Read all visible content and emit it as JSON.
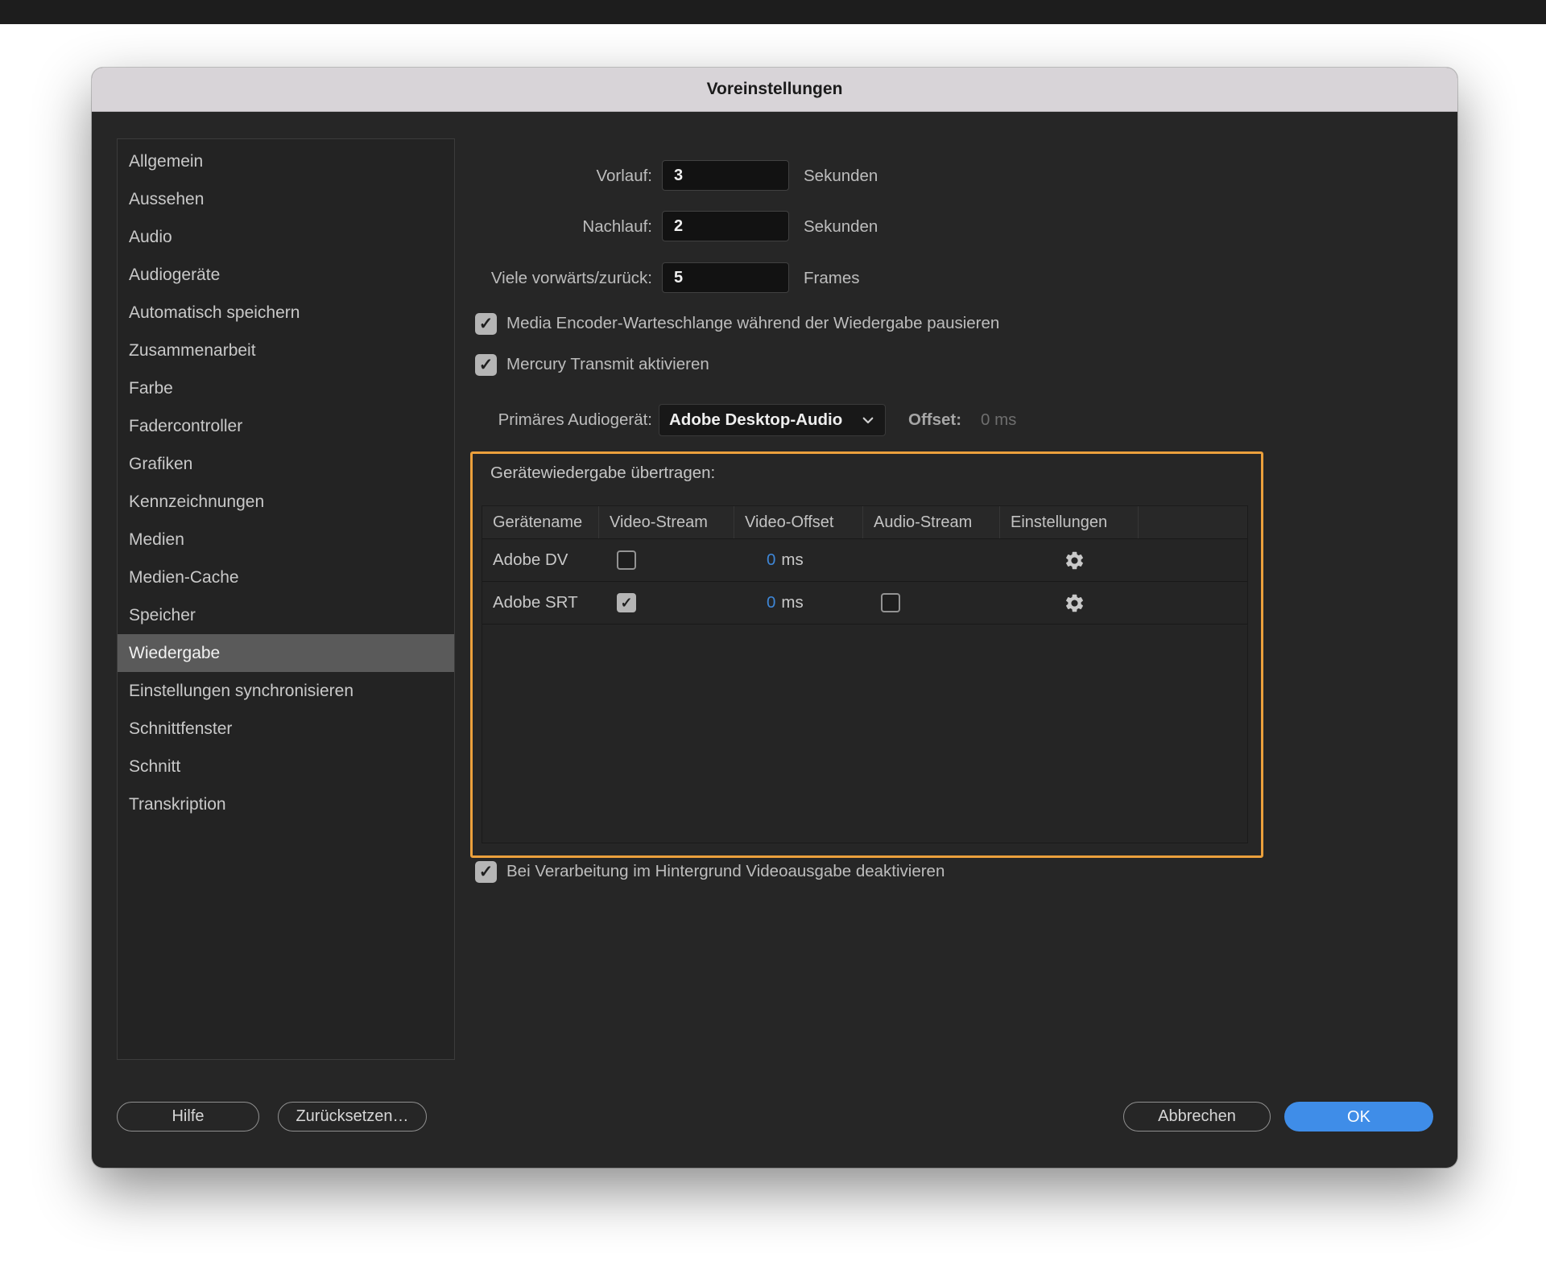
{
  "window": {
    "title": "Voreinstellungen"
  },
  "sidebar": {
    "items": [
      {
        "label": "Allgemein",
        "selected": false
      },
      {
        "label": "Aussehen",
        "selected": false
      },
      {
        "label": "Audio",
        "selected": false
      },
      {
        "label": "Audiogeräte",
        "selected": false
      },
      {
        "label": "Automatisch speichern",
        "selected": false
      },
      {
        "label": "Zusammenarbeit",
        "selected": false
      },
      {
        "label": "Farbe",
        "selected": false
      },
      {
        "label": "Fadercontroller",
        "selected": false
      },
      {
        "label": "Grafiken",
        "selected": false
      },
      {
        "label": "Kennzeichnungen",
        "selected": false
      },
      {
        "label": "Medien",
        "selected": false
      },
      {
        "label": "Medien-Cache",
        "selected": false
      },
      {
        "label": "Speicher",
        "selected": false
      },
      {
        "label": "Wiedergabe",
        "selected": true
      },
      {
        "label": "Einstellungen synchronisieren",
        "selected": false
      },
      {
        "label": "Schnittfenster",
        "selected": false
      },
      {
        "label": "Schnitt",
        "selected": false
      },
      {
        "label": "Transkription",
        "selected": false
      }
    ]
  },
  "form": {
    "fields": [
      {
        "label": "Vorlauf:",
        "value": "3",
        "unit": "Sekunden"
      },
      {
        "label": "Nachlauf:",
        "value": "2",
        "unit": "Sekunden"
      },
      {
        "label": "Viele vorwärts/zurück:",
        "value": "5",
        "unit": "Frames"
      }
    ],
    "checkboxes": [
      {
        "label": "Media Encoder-Warteschlange während der Wiedergabe pausieren",
        "checked": true
      },
      {
        "label": "Mercury Transmit aktivieren",
        "checked": true
      }
    ],
    "primary_audio": {
      "label": "Primäres Audiogerät:",
      "selected_option": "Adobe Desktop-Audio",
      "offset_label": "Offset:",
      "offset_value": "0 ms"
    }
  },
  "device_panel": {
    "title": "Gerätewiedergabe übertragen:",
    "table": {
      "headers": [
        "Gerätename",
        "Video-Stream",
        "Video-Offset",
        "Audio-Stream",
        "Einstellungen"
      ],
      "rows": [
        {
          "name": "Adobe DV",
          "video_stream_checked": false,
          "offset_value": "0",
          "offset_unit": "ms",
          "has_audio_checkbox": false
        },
        {
          "name": "Adobe SRT",
          "video_stream_checked": true,
          "offset_value": "0",
          "offset_unit": "ms",
          "has_audio_checkbox": true,
          "audio_stream_checked": false
        }
      ]
    }
  },
  "footer_checkbox": {
    "label": "Bei Verarbeitung im Hintergrund Videoausgabe deaktivieren",
    "checked": true
  },
  "buttons": {
    "help": "Hilfe",
    "reset": "Zurücksetzen…",
    "cancel": "Abbrechen",
    "ok": "OK"
  },
  "icons": {
    "check": "✓",
    "gear": "gear-glyph",
    "chevron_down": "chevron-down-glyph"
  },
  "colors": {
    "accent_orange": "#EBA03C",
    "value_blue": "#3E86D6",
    "ok_blue": "#3F8DE8",
    "titlebar": "#D8D4D8",
    "dialog_bg": "#262626"
  }
}
